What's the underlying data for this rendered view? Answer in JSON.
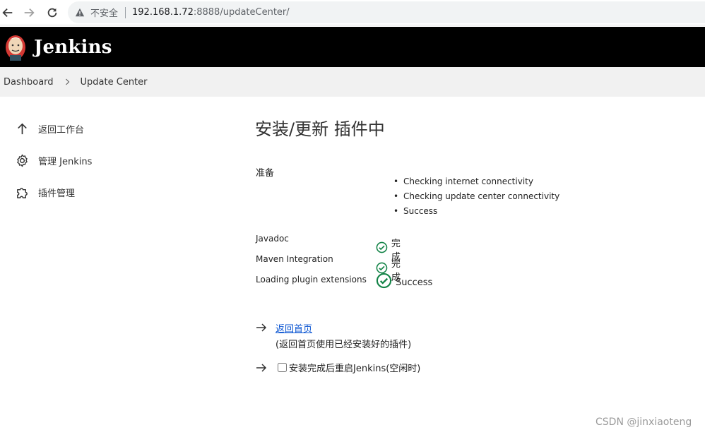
{
  "browser": {
    "security_label": "不安全",
    "url_host": "192.168.1.72",
    "url_rest": ":8888/updateCenter/"
  },
  "header": {
    "brand": "Jenkins"
  },
  "breadcrumb": {
    "items": [
      "Dashboard",
      "Update Center"
    ]
  },
  "sidebar": {
    "items": [
      {
        "label": "返回工作台",
        "icon": "arrow-up-icon"
      },
      {
        "label": "管理 Jenkins",
        "icon": "gear-icon"
      },
      {
        "label": "插件管理",
        "icon": "puzzle-icon"
      }
    ]
  },
  "main": {
    "title": "安装/更新 插件中",
    "prepare_label": "准备",
    "checks": [
      "Checking internet connectivity",
      "Checking update center connectivity",
      "Success"
    ],
    "statuses": [
      {
        "name": "Javadoc",
        "status": "完成"
      },
      {
        "name": "Maven Integration",
        "status": "完成"
      },
      {
        "name": "Loading plugin extensions",
        "status": "Success"
      }
    ],
    "home_link": "返回首页",
    "home_desc": "(返回首页使用已经安装好的插件)",
    "restart_label": "安装完成后重启Jenkins(空闲时)"
  },
  "watermark": "CSDN @jinxiaoteng",
  "colors": {
    "header_bg": "#000000",
    "success_green": "#138347",
    "link_blue": "#0b55d2"
  }
}
